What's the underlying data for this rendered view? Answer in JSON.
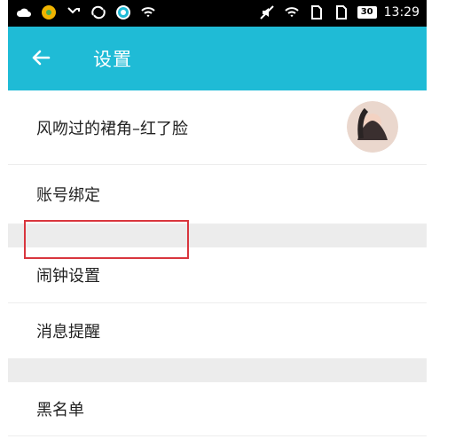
{
  "status_bar": {
    "time": "13:29",
    "battery_level": "30",
    "left_icons": [
      "cloud-icon",
      "app-icon",
      "missed-call-icon",
      "sync-icon",
      "qq-icon",
      "wifi-icon"
    ],
    "right_icons": [
      "silent-icon",
      "wifi-icon",
      "sim-icon",
      "sim-icon",
      "battery-icon"
    ]
  },
  "header": {
    "title": "设置",
    "back_icon": "arrow-left-icon",
    "background_color": "#1fbbd6"
  },
  "settings": {
    "profile_label": "风吻过的裙角–红了脸",
    "account_binding_label": "账号绑定",
    "alarm_label": "闹钟设置",
    "message_reminder_label": "消息提醒",
    "blacklist_label": "黑名单"
  },
  "highlight_color": "#d9363e"
}
